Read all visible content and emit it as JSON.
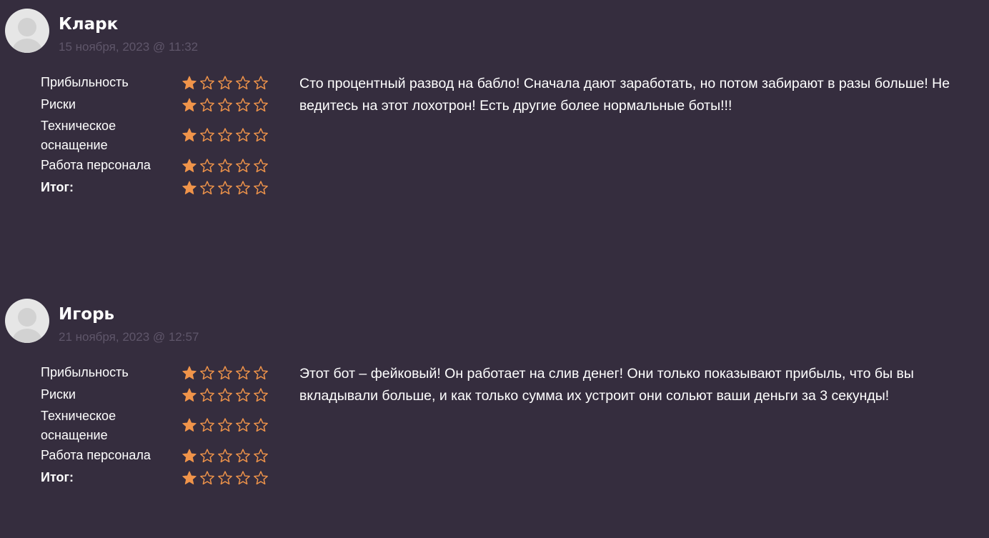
{
  "colors": {
    "background": "#352d3e",
    "star_filled": "#f0944a",
    "star_outline": "#f0944a",
    "date_text": "#5f566a",
    "text": "#ffffff"
  },
  "reviews": [
    {
      "author": "Кларк",
      "date": "15 ноября, 2023 @ 11:32",
      "ratings": [
        {
          "label": "Прибыльность",
          "stars_filled": 1,
          "stars_total": 5
        },
        {
          "label": "Риски",
          "stars_filled": 1,
          "stars_total": 5
        },
        {
          "label": "Техническое оснащение",
          "stars_filled": 1,
          "stars_total": 5
        },
        {
          "label": "Работа персонала",
          "stars_filled": 1,
          "stars_total": 5
        },
        {
          "label": "Итог:",
          "stars_filled": 1,
          "stars_total": 5
        }
      ],
      "text": "Сто процентный развод на бабло! Сначала дают заработать, но потом забирают в разы больше! Не ведитесь на этот лохотрон! Есть другие более нормальные боты!!!"
    },
    {
      "author": "Игорь",
      "date": "21 ноября, 2023 @ 12:57",
      "ratings": [
        {
          "label": "Прибыльность",
          "stars_filled": 1,
          "stars_total": 5
        },
        {
          "label": "Риски",
          "stars_filled": 1,
          "stars_total": 5
        },
        {
          "label": "Техническое оснащение",
          "stars_filled": 1,
          "stars_total": 5
        },
        {
          "label": "Работа персонала",
          "stars_filled": 1,
          "stars_total": 5
        },
        {
          "label": "Итог:",
          "stars_filled": 1,
          "stars_total": 5
        }
      ],
      "text": "Этот бот – фейковый! Он работает на слив денег! Они только показывают прибыль, что бы вы вкладывали больше, и как только сумма их устроит они сольют ваши деньги за 3 секунды!"
    }
  ],
  "icons": {
    "avatar": "user-avatar-placeholder",
    "star_filled": "star-filled-icon",
    "star_empty": "star-outline-icon"
  }
}
